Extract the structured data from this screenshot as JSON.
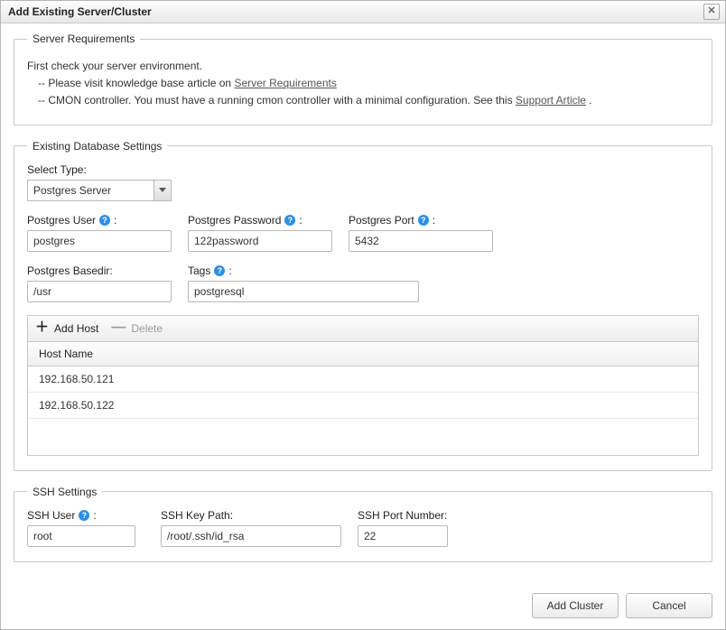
{
  "title": "Add Existing Server/Cluster",
  "close_tooltip": "Close",
  "requirements": {
    "legend": "Server Requirements",
    "intro": "First check your server environment.",
    "line1_prefix": "-- Please visit knowledge base article on ",
    "line1_link": "Server Requirements",
    "line2_prefix": "-- CMON controller. You must have a running cmon controller with a minimal configuration. See this ",
    "line2_link": "Support Article",
    "line2_suffix": " ."
  },
  "db": {
    "legend": "Existing Database Settings",
    "type_label": "Select Type:",
    "type_value": "Postgres Server",
    "user_label": "Postgres User",
    "user_value": "postgres",
    "password_label": "Postgres Password",
    "password_value": "122password",
    "port_label": "Postgres Port",
    "port_value": "5432",
    "basedir_label": "Postgres Basedir:",
    "basedir_value": "/usr",
    "tags_label": "Tags",
    "tags_value": "postgresql",
    "add_host_label": "Add Host",
    "delete_label": "Delete",
    "host_header": "Host Name",
    "hosts": [
      "192.168.50.121",
      "192.168.50.122"
    ]
  },
  "ssh": {
    "legend": "SSH Settings",
    "user_label": "SSH User",
    "user_value": "root",
    "key_label": "SSH Key Path:",
    "key_value": "/root/.ssh/id_rsa",
    "port_label": "SSH Port Number:",
    "port_value": "22"
  },
  "buttons": {
    "add_cluster": "Add Cluster",
    "cancel": "Cancel"
  }
}
